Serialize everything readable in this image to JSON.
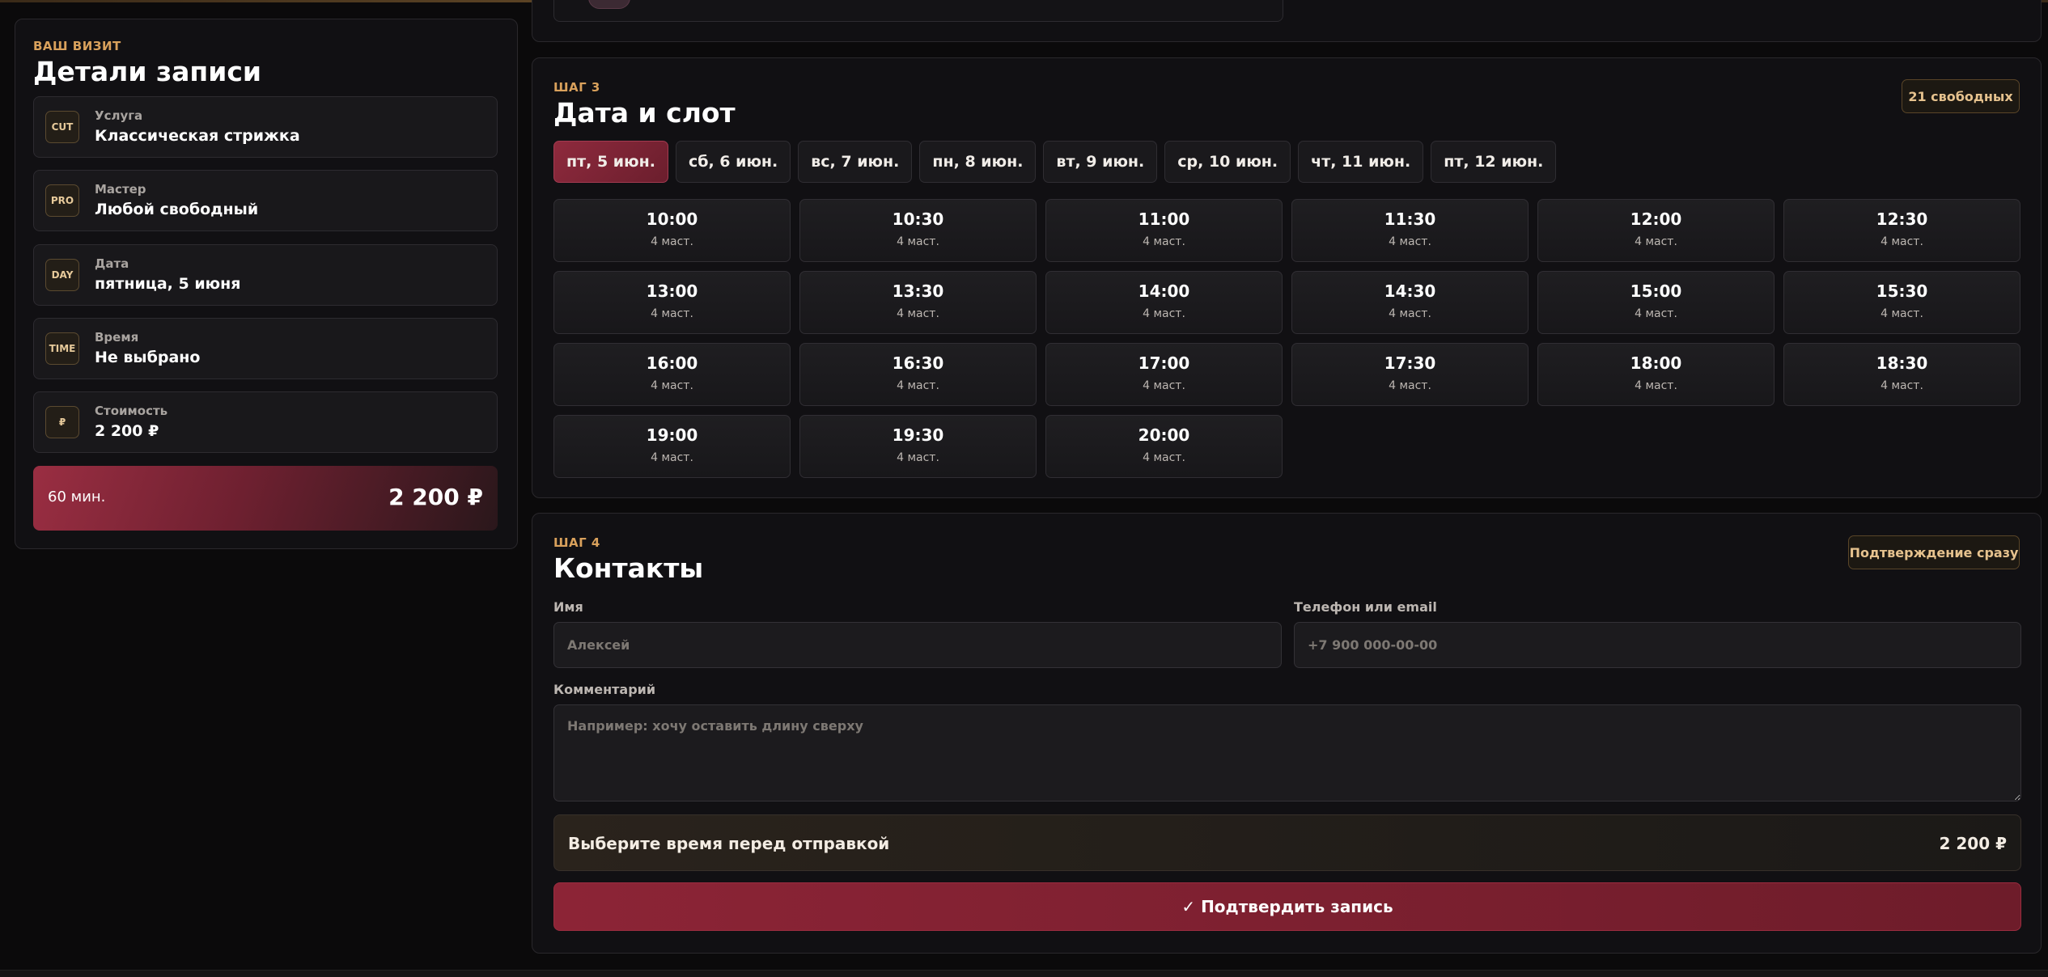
{
  "summary": {
    "eyebrow": "ВАШ ВИЗИТ",
    "title": "Детали записи",
    "rows": [
      {
        "icon": "CUT",
        "label": "Услуга",
        "value": "Классическая стрижка"
      },
      {
        "icon": "PRO",
        "label": "Мастер",
        "value": "Любой свободный"
      },
      {
        "icon": "DAY",
        "label": "Дата",
        "value": "пятница, 5 июня"
      },
      {
        "icon": "TIME",
        "label": "Время",
        "value": "Не выбрано"
      },
      {
        "icon": "₽",
        "label": "Стоимость",
        "value": "2 200 ₽"
      }
    ],
    "duration": "60 мин.",
    "total": "2 200 ₽"
  },
  "step3": {
    "eyebrow": "ШАГ 3",
    "title": "Дата и слот",
    "free_badge": "21 свободных",
    "dates": [
      "пт, 5 июн.",
      "сб, 6 июн.",
      "вс, 7 июн.",
      "пн, 8 июн.",
      "вт, 9 июн.",
      "ср, 10 июн.",
      "чт, 11 июн.",
      "пт, 12 июн."
    ],
    "selected_date": "пт, 5 июн.",
    "slots": [
      {
        "time": "10:00",
        "masters": "4 маст."
      },
      {
        "time": "10:30",
        "masters": "4 маст."
      },
      {
        "time": "11:00",
        "masters": "4 маст."
      },
      {
        "time": "11:30",
        "masters": "4 маст."
      },
      {
        "time": "12:00",
        "masters": "4 маст."
      },
      {
        "time": "12:30",
        "masters": "4 маст."
      },
      {
        "time": "13:00",
        "masters": "4 маст."
      },
      {
        "time": "13:30",
        "masters": "4 маст."
      },
      {
        "time": "14:00",
        "masters": "4 маст."
      },
      {
        "time": "14:30",
        "masters": "4 маст."
      },
      {
        "time": "15:00",
        "masters": "4 маст."
      },
      {
        "time": "15:30",
        "masters": "4 маст."
      },
      {
        "time": "16:00",
        "masters": "4 маст."
      },
      {
        "time": "16:30",
        "masters": "4 маст."
      },
      {
        "time": "17:00",
        "masters": "4 маст."
      },
      {
        "time": "17:30",
        "masters": "4 маст."
      },
      {
        "time": "18:00",
        "masters": "4 маст."
      },
      {
        "time": "18:30",
        "masters": "4 маст."
      },
      {
        "time": "19:00",
        "masters": "4 маст."
      },
      {
        "time": "19:30",
        "masters": "4 маст."
      },
      {
        "time": "20:00",
        "masters": "4 маст."
      }
    ]
  },
  "step4": {
    "eyebrow": "ШАГ 4",
    "title": "Контакты",
    "confirm_badge": "Подтверждение сразу",
    "name_label": "Имя",
    "name_placeholder": "Алексей",
    "contact_label": "Телефон или email",
    "contact_placeholder": "+7 900 000-00-00",
    "comment_label": "Комментарий",
    "comment_placeholder": "Например: хочу оставить длину сверху",
    "notice": "Выберите время перед отправкой",
    "notice_amount": "2 200 ₽",
    "submit": "✓ Подтвердить запись"
  }
}
